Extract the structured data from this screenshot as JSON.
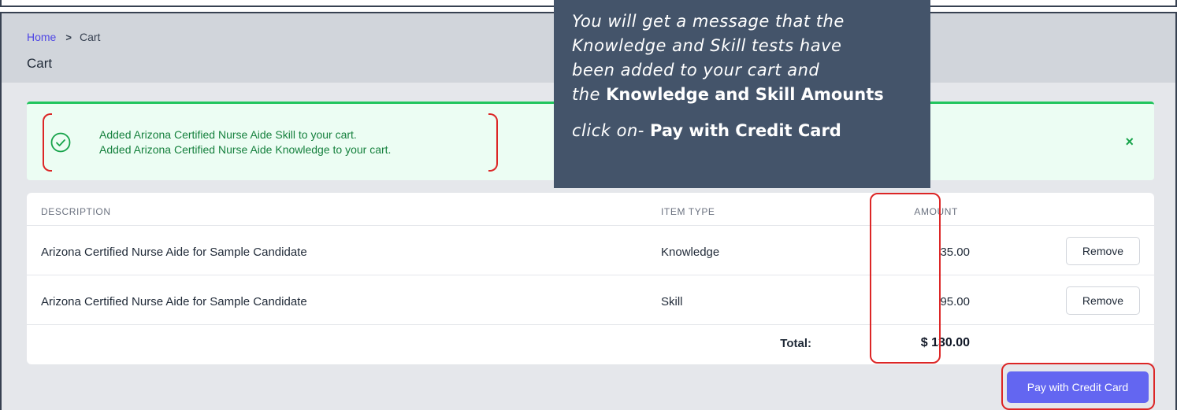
{
  "breadcrumb": {
    "home": "Home",
    "separator": ">",
    "current": "Cart"
  },
  "page_title": "Cart",
  "alert": {
    "messages": [
      "Added Arizona Certified Nurse Aide Skill to your cart.",
      "Added Arizona Certified Nurse Aide Knowledge to your cart."
    ],
    "close_symbol": "×",
    "icon": "check-circle-icon",
    "color": "#16a34a"
  },
  "table": {
    "headers": {
      "description": "DESCRIPTION",
      "item_type": "ITEM TYPE",
      "amount": "AMOUNT"
    },
    "rows": [
      {
        "description": "Arizona Certified Nurse Aide for Sample Candidate",
        "item_type": "Knowledge",
        "amount": "35.00",
        "action": "Remove"
      },
      {
        "description": "Arizona Certified Nurse Aide for Sample Candidate",
        "item_type": "Skill",
        "amount": "95.00",
        "action": "Remove"
      }
    ],
    "total_label": "Total:",
    "total_value": "$ 130.00"
  },
  "pay_button": {
    "label": "Pay with Credit Card",
    "color": "#6366f1"
  },
  "callout": {
    "line1": "You will get a message that the",
    "line2": "Knowledge and Skill tests have",
    "line3": "been added to your cart and",
    "line4_italic": "the",
    "line4_bold": "Knowledge and Skill Amounts",
    "line5_italic": "click on-",
    "line5_bold": "Pay with Credit Card",
    "background": "#44546a"
  },
  "annotation_color": "#dc2626"
}
